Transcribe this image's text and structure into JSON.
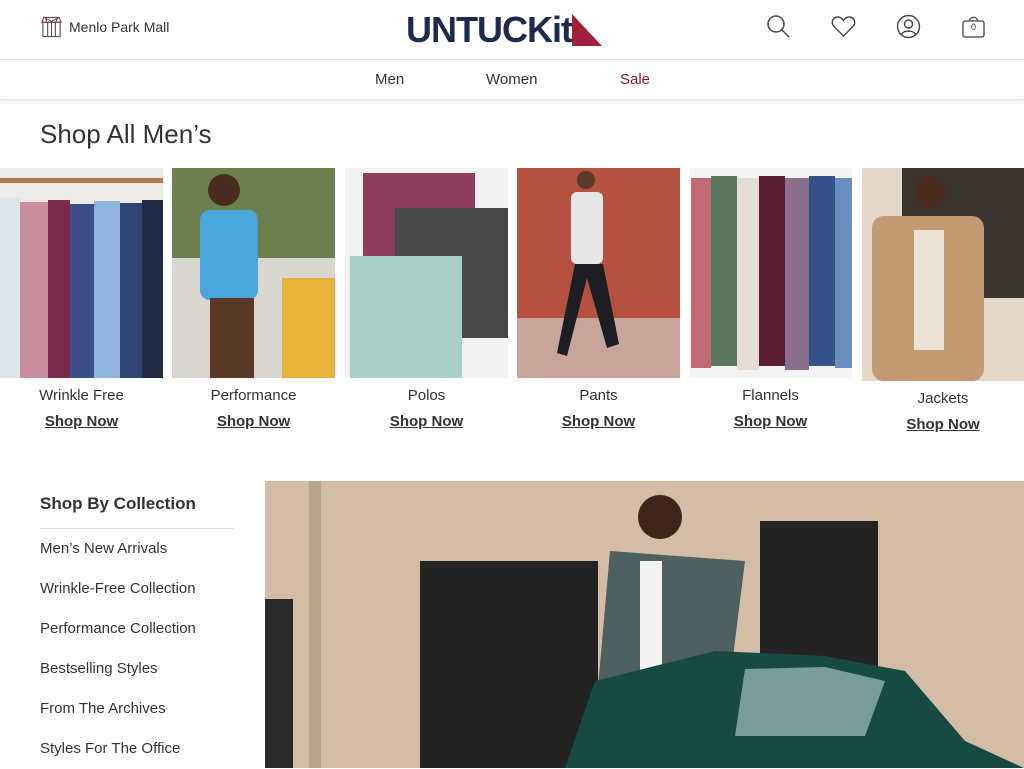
{
  "header": {
    "store_name": "Menlo Park Mall",
    "logo_text": "UNTUCKit",
    "cart_count": "0",
    "icons": [
      "store-icon",
      "search-icon",
      "heart-icon",
      "account-icon",
      "cart-icon"
    ]
  },
  "nav": {
    "items": [
      {
        "label": "Men"
      },
      {
        "label": "Women"
      },
      {
        "label": "Sale"
      }
    ]
  },
  "page": {
    "title": "Shop All Men’s"
  },
  "categories": [
    {
      "label": "Wrinkle Free",
      "cta": "Shop Now"
    },
    {
      "label": "Performance",
      "cta": "Shop Now"
    },
    {
      "label": "Polos",
      "cta": "Shop Now"
    },
    {
      "label": "Pants",
      "cta": "Shop Now"
    },
    {
      "label": "Flannels",
      "cta": "Shop Now"
    },
    {
      "label": "Jackets",
      "cta": "Shop Now"
    }
  ],
  "collections": {
    "heading": "Shop By Collection",
    "items": [
      "Men’s New Arrivals",
      "Wrinkle-Free Collection",
      "Performance Collection",
      "Bestselling Styles",
      "From The Archives",
      "Styles For The Office"
    ]
  },
  "colors": {
    "brand_navy": "#1d2b4f",
    "brand_red": "#a3203a",
    "sale": "#7c1a2b",
    "text": "#333333"
  }
}
